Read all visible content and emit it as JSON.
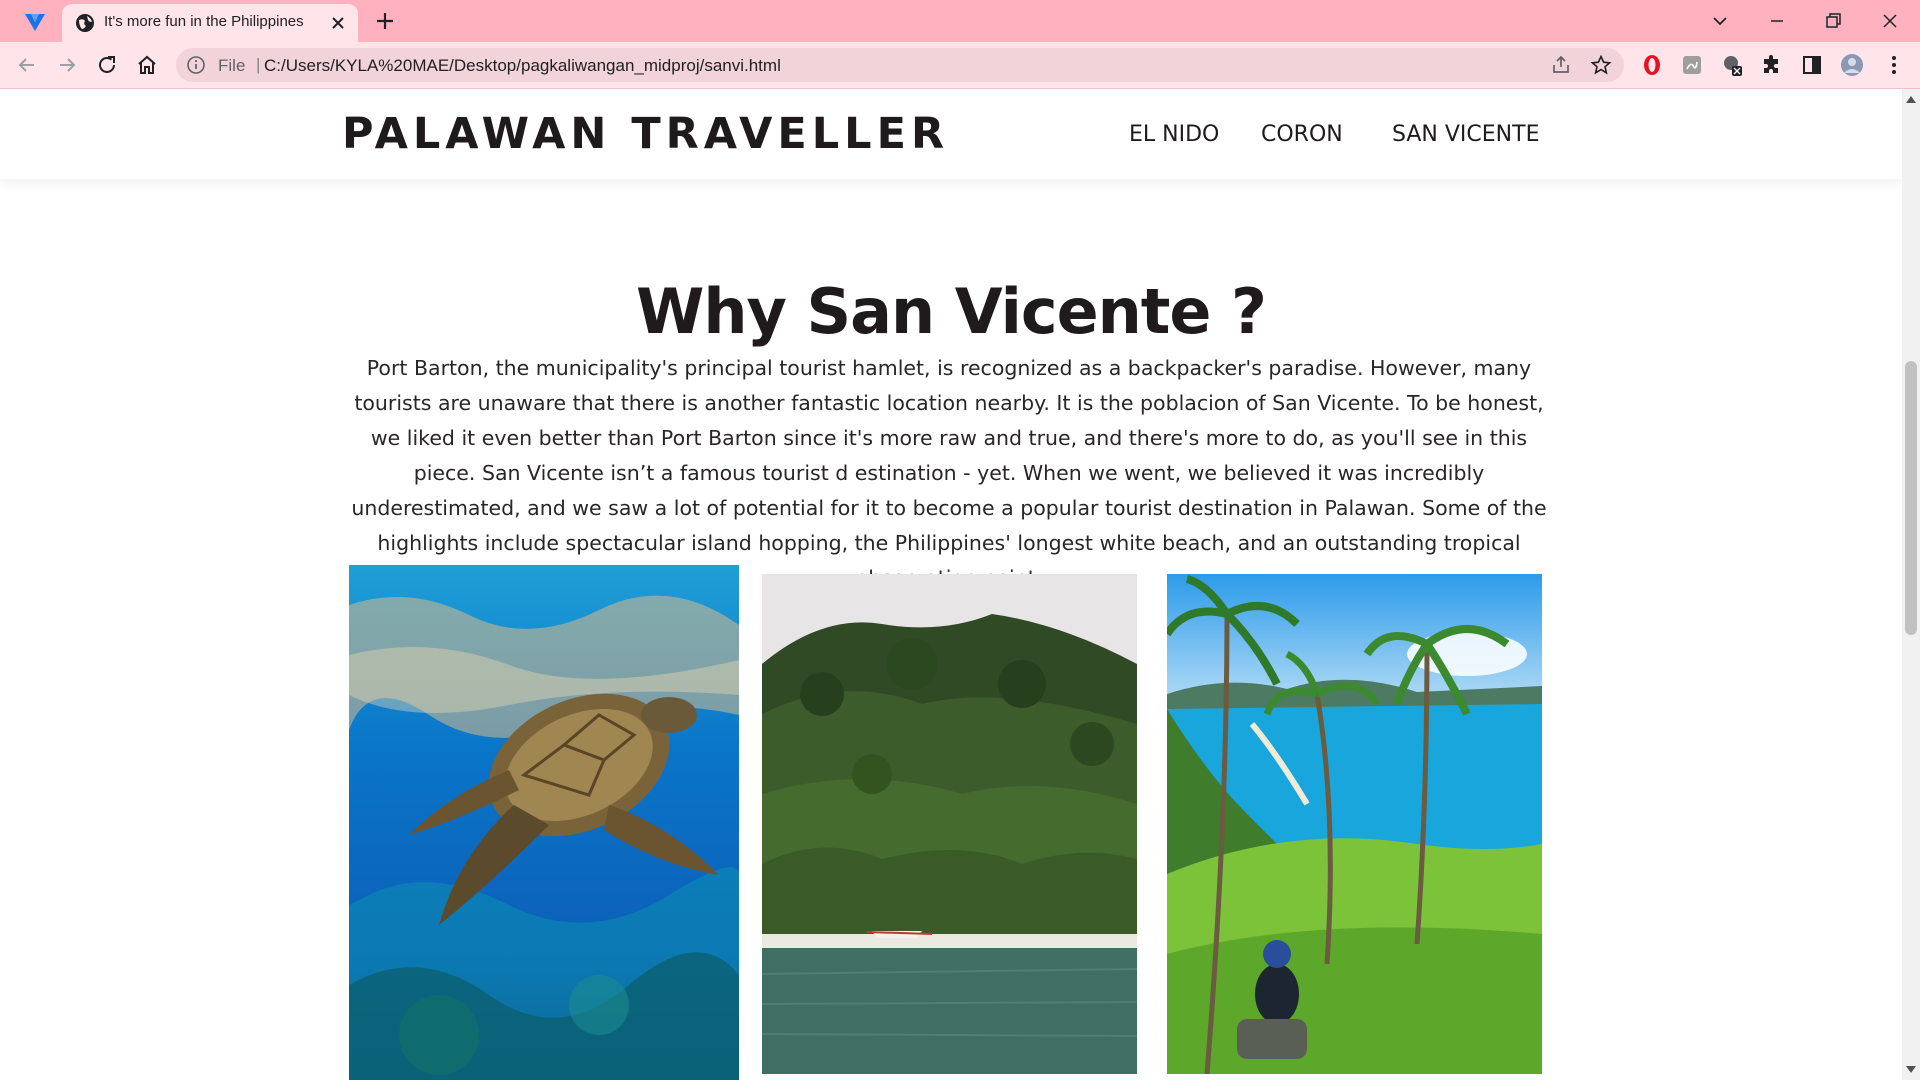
{
  "browser": {
    "tab_title": "It's more fun in the Philippines",
    "address_scheme": "File",
    "address_separator": "|",
    "address_url": "C:/Users/KYLA%20MAE/Desktop/pagkaliwangan_midproj/sanvi.html",
    "colors": {
      "tabstrip": "#ffb1c0",
      "toolbar": "#ffe4ea",
      "omnibox": "#f2d3da"
    }
  },
  "site": {
    "brand": "PALAWAN TRAVELLER",
    "nav": [
      {
        "label": "EL NIDO"
      },
      {
        "label": "CORON"
      },
      {
        "label": "SAN VICENTE"
      }
    ]
  },
  "main": {
    "heading": "Why San Vicente ?",
    "intro": "Port Barton, the municipality's principal tourist hamlet, is recognized as a backpacker's paradise. However, many tourists are unaware that there is another fantastic location nearby. It is the poblacion of San Vicente. To be honest, we liked it even better than Port Barton since it's more raw and true, and there's more to do, as you'll see in this piece. San Vicente isn’t a famous tourist d estination - yet. When we went, we believed it was incredibly underestimated, and we saw a lot of potential for it to become a popular tourist destination in Palawan. Some of the highlights include spectacular island hopping, the Philippines' longest white beach, and an outstanding tropical observation point.",
    "photos": [
      {
        "subject": "sea turtle swimming underwater"
      },
      {
        "subject": "forested hill above a beach with a boat"
      },
      {
        "subject": "palm trees on a grassy hill overlooking the coast"
      }
    ]
  },
  "icons": [
    "back-icon",
    "forward-icon",
    "reload-icon",
    "home-icon",
    "info-icon",
    "share-icon",
    "star-icon",
    "extensions-icon",
    "side-panel-icon",
    "profile-avatar",
    "menu-icon"
  ]
}
